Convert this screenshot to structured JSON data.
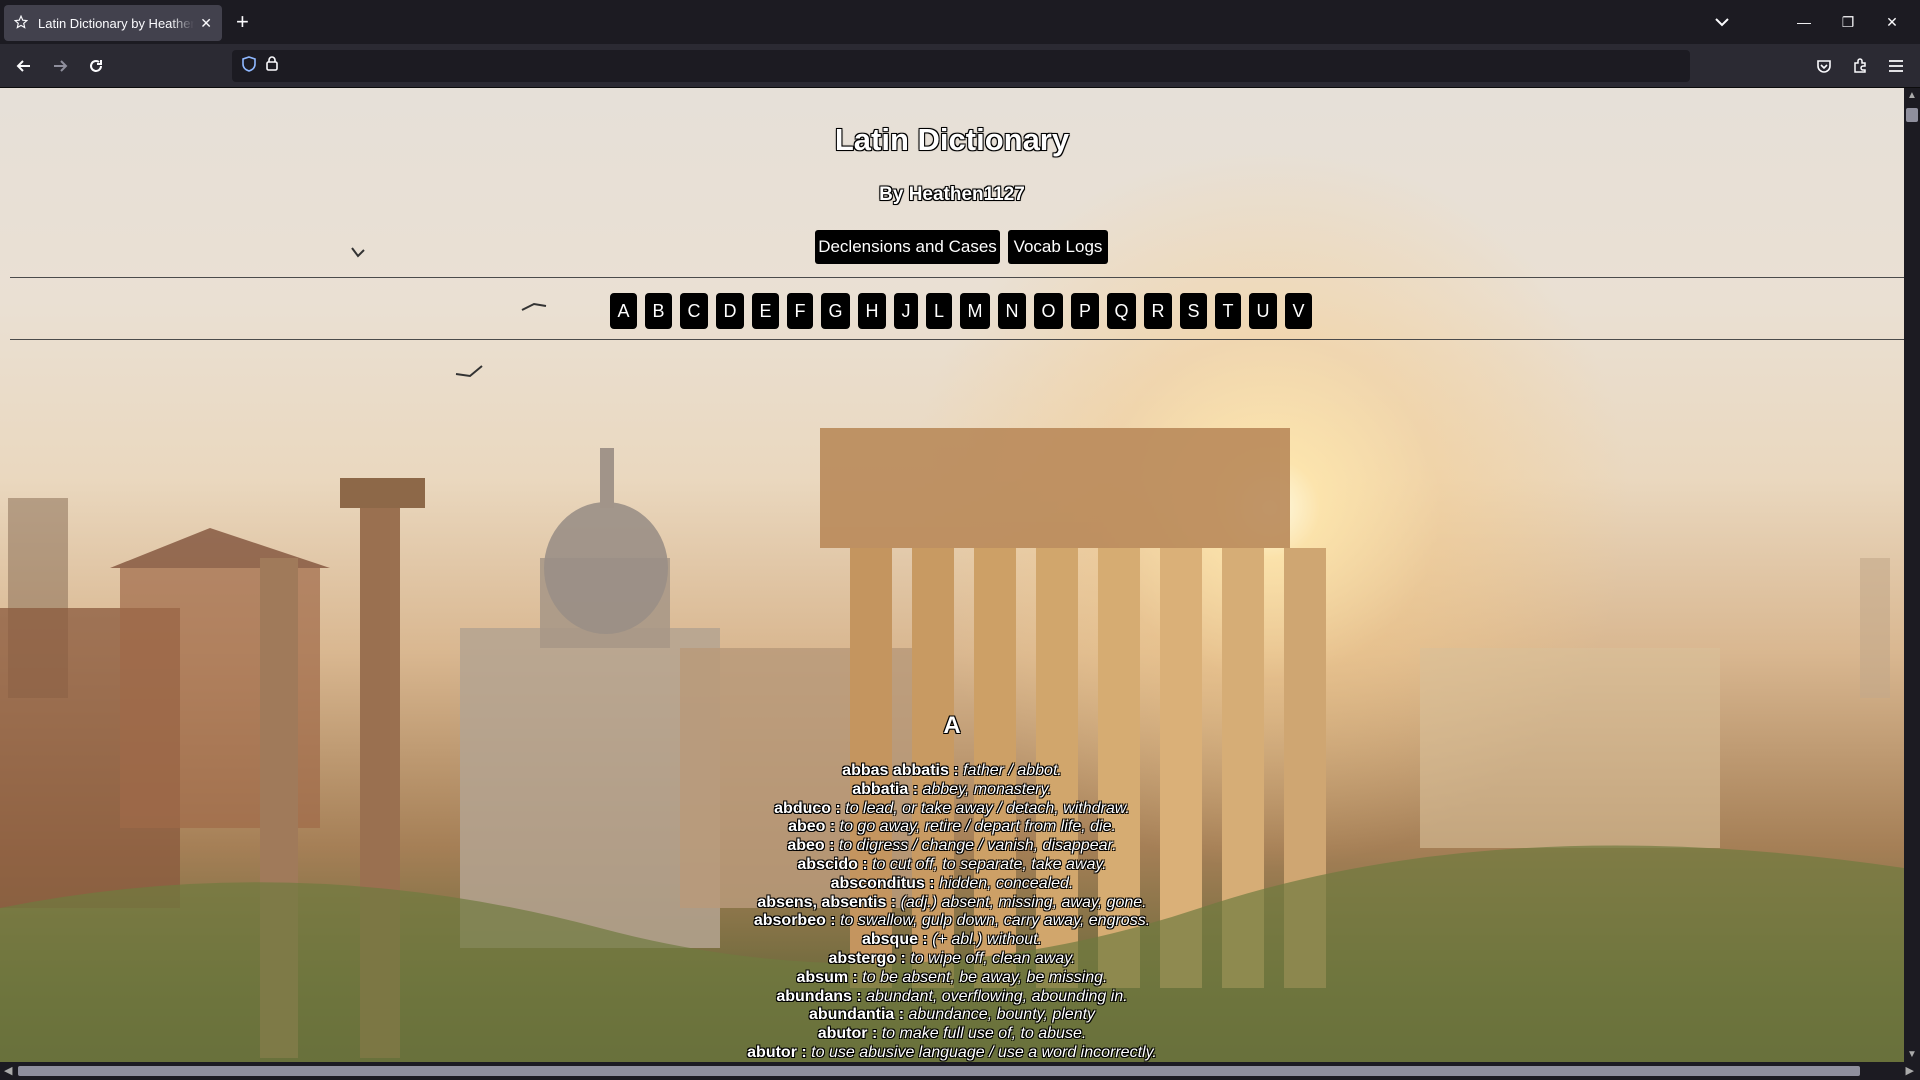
{
  "browser": {
    "tab_title": "Latin Dictionary by Heathen1127",
    "tab_icon": "star-icon",
    "url": ""
  },
  "page": {
    "title": "Latin Dictionary",
    "subtitle": "By Heathen1127",
    "nav_buttons": [
      "Declensions and Cases",
      "Vocab Logs"
    ],
    "letters": [
      "A",
      "B",
      "C",
      "D",
      "E",
      "F",
      "G",
      "H",
      "J",
      "L",
      "M",
      "N",
      "O",
      "P",
      "Q",
      "R",
      "S",
      "T",
      "U",
      "V"
    ],
    "section_letter": "A",
    "entries": [
      {
        "word": "abbas abbatis",
        "def": "father / abbot."
      },
      {
        "word": "abbatia",
        "def": "abbey, monastery."
      },
      {
        "word": "abduco",
        "def": "to lead, or take away / detach, withdraw."
      },
      {
        "word": "abeo",
        "def": "to go away, retire / depart from life, die."
      },
      {
        "word": "abeo",
        "def": "to digress / change / vanish, disappear."
      },
      {
        "word": "abscido",
        "def": "to cut off, to separate, take away."
      },
      {
        "word": "absconditus",
        "def": "hidden, concealed."
      },
      {
        "word": "absens, absentis",
        "def": "(adj.) absent, missing, away, gone."
      },
      {
        "word": "absorbeo",
        "def": "to swallow, gulp down, carry away, engross."
      },
      {
        "word": "absque",
        "def": "(+ abl.) without."
      },
      {
        "word": "abstergo",
        "def": "to wipe off, clean away."
      },
      {
        "word": "absum",
        "def": "to be absent, be away, be missing."
      },
      {
        "word": "abundans",
        "def": "abundant, overflowing, abounding in."
      },
      {
        "word": "abundantia",
        "def": "abundance, bounty, plenty"
      },
      {
        "word": "abutor",
        "def": "to make full use of, to abuse."
      },
      {
        "word": "abutor",
        "def": "to use abusive language / use a word incorrectly."
      }
    ]
  }
}
